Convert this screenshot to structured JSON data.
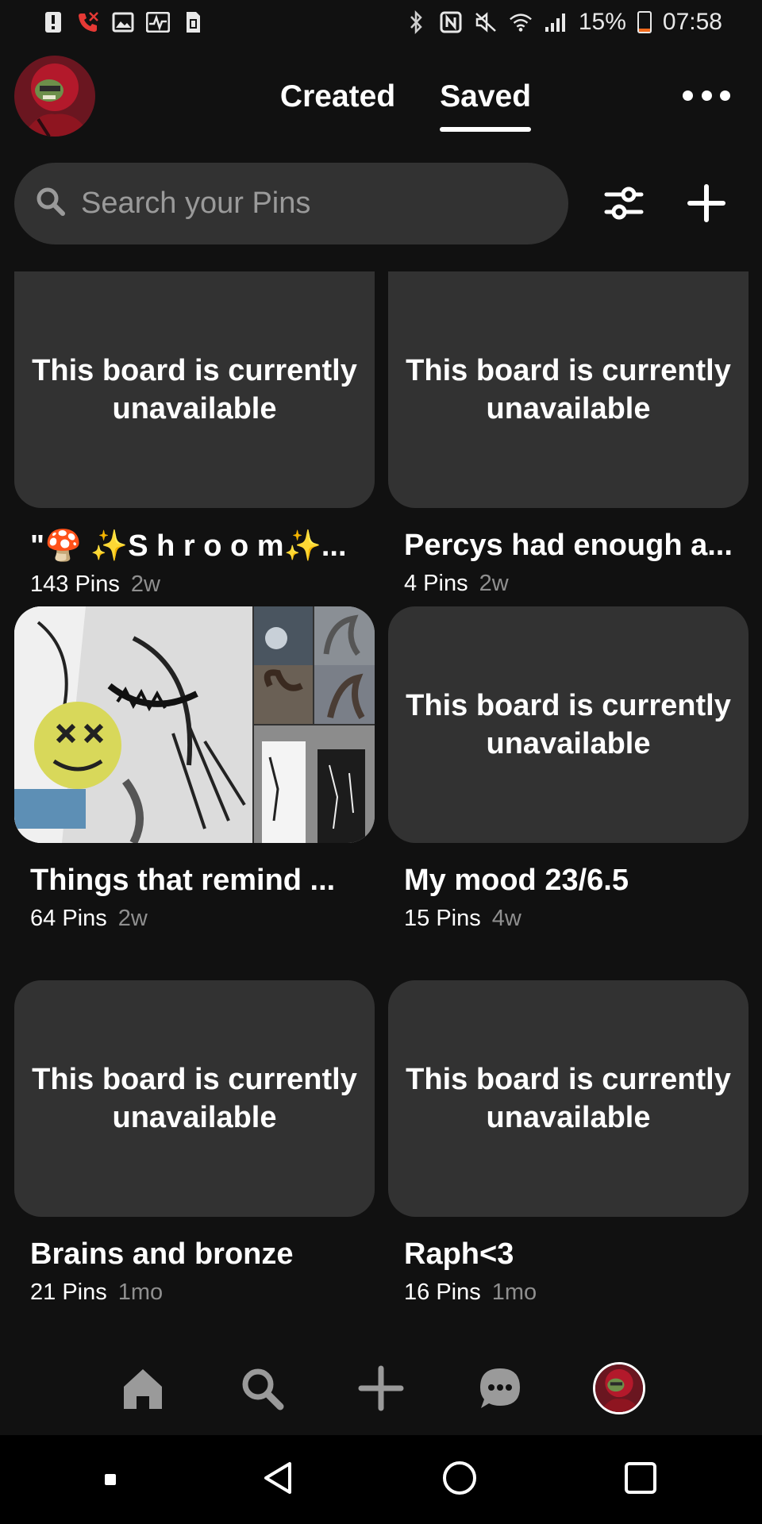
{
  "status_bar": {
    "left_icons": [
      "alert-icon",
      "missed-call-icon",
      "gallery-icon",
      "activity-icon",
      "sim-icon"
    ],
    "right_icons": [
      "bluetooth-icon",
      "nfc-icon",
      "mute-icon",
      "wifi-icon",
      "signal-icon"
    ],
    "battery_percent": "15%",
    "battery_level": 0.15,
    "time": "07:58"
  },
  "header": {
    "tabs": [
      {
        "label": "Created",
        "active": false
      },
      {
        "label": "Saved",
        "active": true
      }
    ],
    "more_icon": "more-dots-icon"
  },
  "search": {
    "placeholder": "Search your Pins",
    "value": ""
  },
  "boards": [
    {
      "unavailable_text": "This board is currently unavailable",
      "title": "\"🍄 ✨S h r o o m✨...",
      "pins": "143 Pins",
      "age": "2w"
    },
    {
      "unavailable_text": "This board is currently unavailable",
      "title": "Percys had enough a...",
      "pins": "4 Pins",
      "age": "2w"
    },
    {
      "unavailable_text": "",
      "title": "Things that remind ...",
      "pins": "64 Pins",
      "age": "2w"
    },
    {
      "unavailable_text": "This board is currently unavailable",
      "title": "My mood 23/6.5",
      "pins": "15 Pins",
      "age": "4w"
    },
    {
      "unavailable_text": "This board is currently unavailable",
      "title": "Brains and bronze",
      "pins": "21 Pins",
      "age": "1mo"
    },
    {
      "unavailable_text": "This board is currently unavailable",
      "title": "Raph<3",
      "pins": "16 Pins",
      "age": "1mo"
    }
  ],
  "bottom_nav": [
    "home-icon",
    "search-icon",
    "create-icon",
    "messages-icon",
    "profile-avatar"
  ],
  "system_nav": [
    "square-dot-icon",
    "back-icon",
    "home-circle-icon",
    "recents-icon"
  ],
  "colors": {
    "background": "#111111",
    "card": "#323232",
    "battery_low": "#f26b1d",
    "muted_text": "#8f8f8f"
  }
}
